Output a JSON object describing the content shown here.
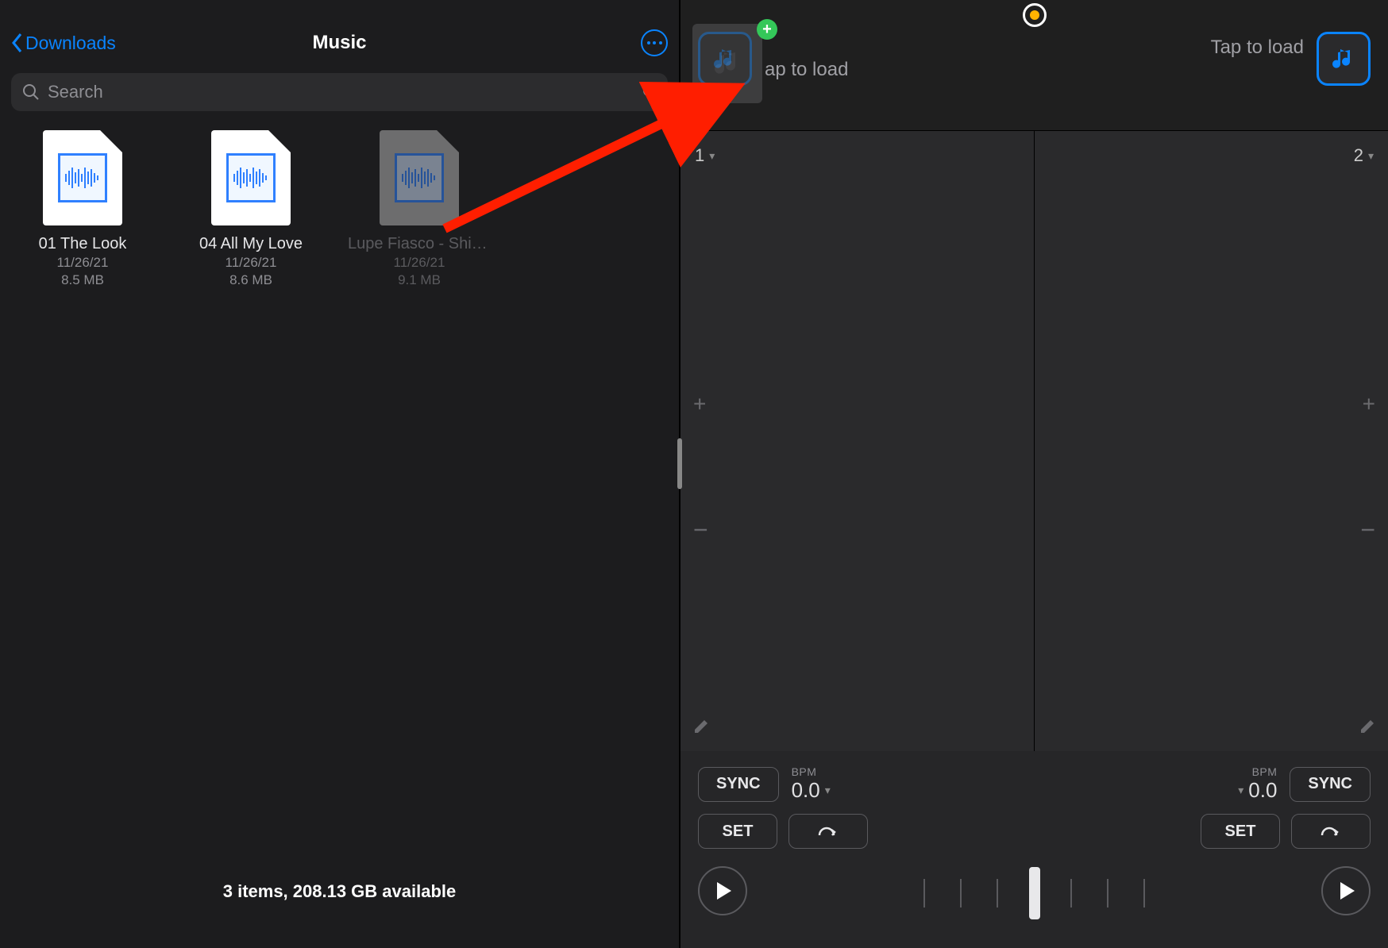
{
  "files": {
    "back_label": "Downloads",
    "title": "Music",
    "search_placeholder": "Search",
    "items": [
      {
        "name": "01 The Look",
        "date": "11/26/21",
        "size": "8.5 MB"
      },
      {
        "name": "04 All My Love",
        "date": "11/26/21",
        "size": "8.6 MB"
      },
      {
        "name": "Lupe Fiasco - Shinin…antos)",
        "date": "11/26/21",
        "size": "9.1 MB"
      }
    ],
    "status": "3 items, 208.13 GB available"
  },
  "dj": {
    "deck_a": {
      "load_label": "ap to load",
      "number": "1",
      "bpm_label": "BPM",
      "bpm_value": "0.0",
      "sync": "SYNC",
      "set": "SET"
    },
    "deck_b": {
      "load_label": "Tap to load",
      "number": "2",
      "bpm_label": "BPM",
      "bpm_value": "0.0",
      "sync": "SYNC",
      "set": "SET"
    }
  },
  "icons": {
    "plus": "+",
    "minus": "−"
  }
}
